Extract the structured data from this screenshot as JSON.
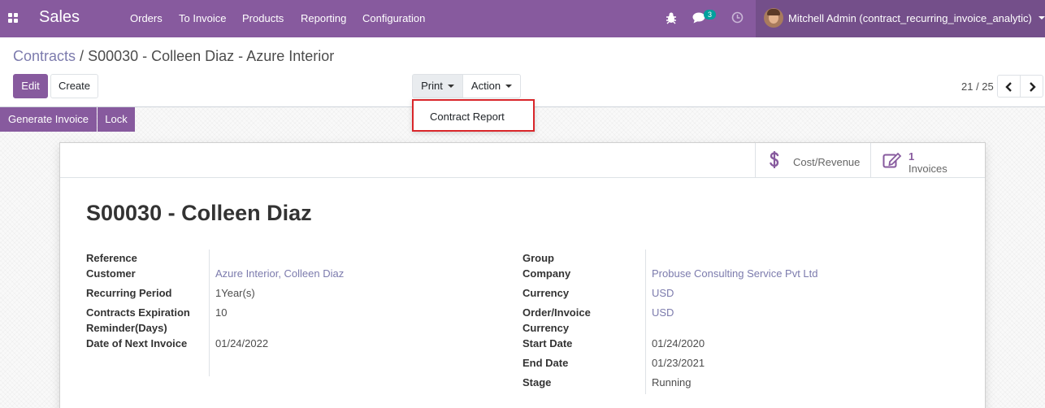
{
  "navbar": {
    "app_name": "Sales",
    "menu": [
      "Orders",
      "To Invoice",
      "Products",
      "Reporting",
      "Configuration"
    ],
    "messages_count": "3",
    "user_name": "Mitchell Admin (contract_recurring_invoice_analytic)"
  },
  "breadcrumb": {
    "parent": "Contracts",
    "separator": "/",
    "current": "S00030 - Colleen Diaz - Azure Interior"
  },
  "toolbar": {
    "edit_label": "Edit",
    "create_label": "Create",
    "print_label": "Print",
    "action_label": "Action",
    "pager_value": "21 / 25"
  },
  "print_menu": {
    "items": [
      "Contract Report"
    ]
  },
  "statusbar": {
    "generate_invoice_label": "Generate Invoice",
    "lock_label": "Lock"
  },
  "smart_buttons": {
    "cost_revenue_label": "Cost/Revenue",
    "invoices_count": "1",
    "invoices_label": "Invoices"
  },
  "record": {
    "title": "S00030 - Colleen Diaz",
    "left_fields": [
      {
        "label": "Reference",
        "value": ""
      },
      {
        "label": "Customer",
        "value": "Azure Interior, Colleen Diaz"
      },
      {
        "label": "Recurring Period",
        "value": "1Year(s)"
      },
      {
        "label": "Contracts Expiration Reminder(Days)",
        "label_line1": "Contracts Expiration",
        "label_line2": "Reminder(Days)",
        "value": "10"
      },
      {
        "label": "Date of Next Invoice",
        "value": "01/24/2022"
      }
    ],
    "right_fields": [
      {
        "label": "Group",
        "value": ""
      },
      {
        "label": "Company",
        "value": "Probuse Consulting Service Pvt Ltd"
      },
      {
        "label": "Currency",
        "value": "USD"
      },
      {
        "label": "Order/Invoice Currency",
        "label_line1": "Order/Invoice",
        "label_line2": "Currency",
        "value": "USD"
      },
      {
        "label": "Start Date",
        "value": "01/24/2020"
      },
      {
        "label": "End Date",
        "value": "01/23/2021"
      },
      {
        "label": "Stage",
        "value": "Running"
      }
    ]
  },
  "colors": {
    "brand": "#875a9e",
    "link": "#7c7bad",
    "highlight": "#d9262a"
  }
}
